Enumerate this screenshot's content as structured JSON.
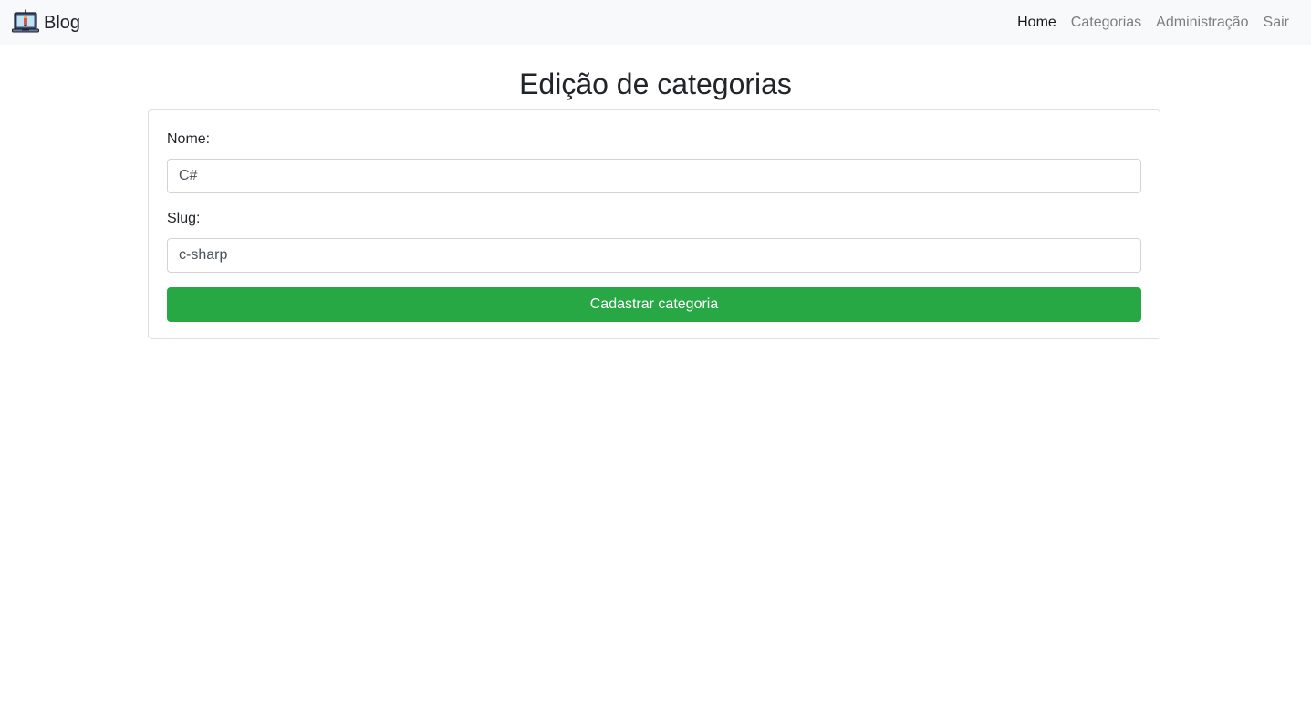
{
  "navbar": {
    "brand": {
      "text": "Blog",
      "icon": "laptop-icon"
    },
    "links": [
      {
        "label": "Home",
        "active": true
      },
      {
        "label": "Categorias",
        "active": false
      },
      {
        "label": "Administração",
        "active": false
      },
      {
        "label": "Sair",
        "active": false
      }
    ]
  },
  "page": {
    "title": "Edição de categorias"
  },
  "form": {
    "name_label": "Nome:",
    "name_value": "C#",
    "slug_label": "Slug:",
    "slug_value": "c-sharp",
    "submit_label": "Cadastrar categoria"
  },
  "colors": {
    "navbar_bg": "#f8f9fa",
    "button_green": "#28a745",
    "nav_active": "rgba(0,0,0,0.9)",
    "nav_inactive": "rgba(0,0,0,0.5)"
  }
}
